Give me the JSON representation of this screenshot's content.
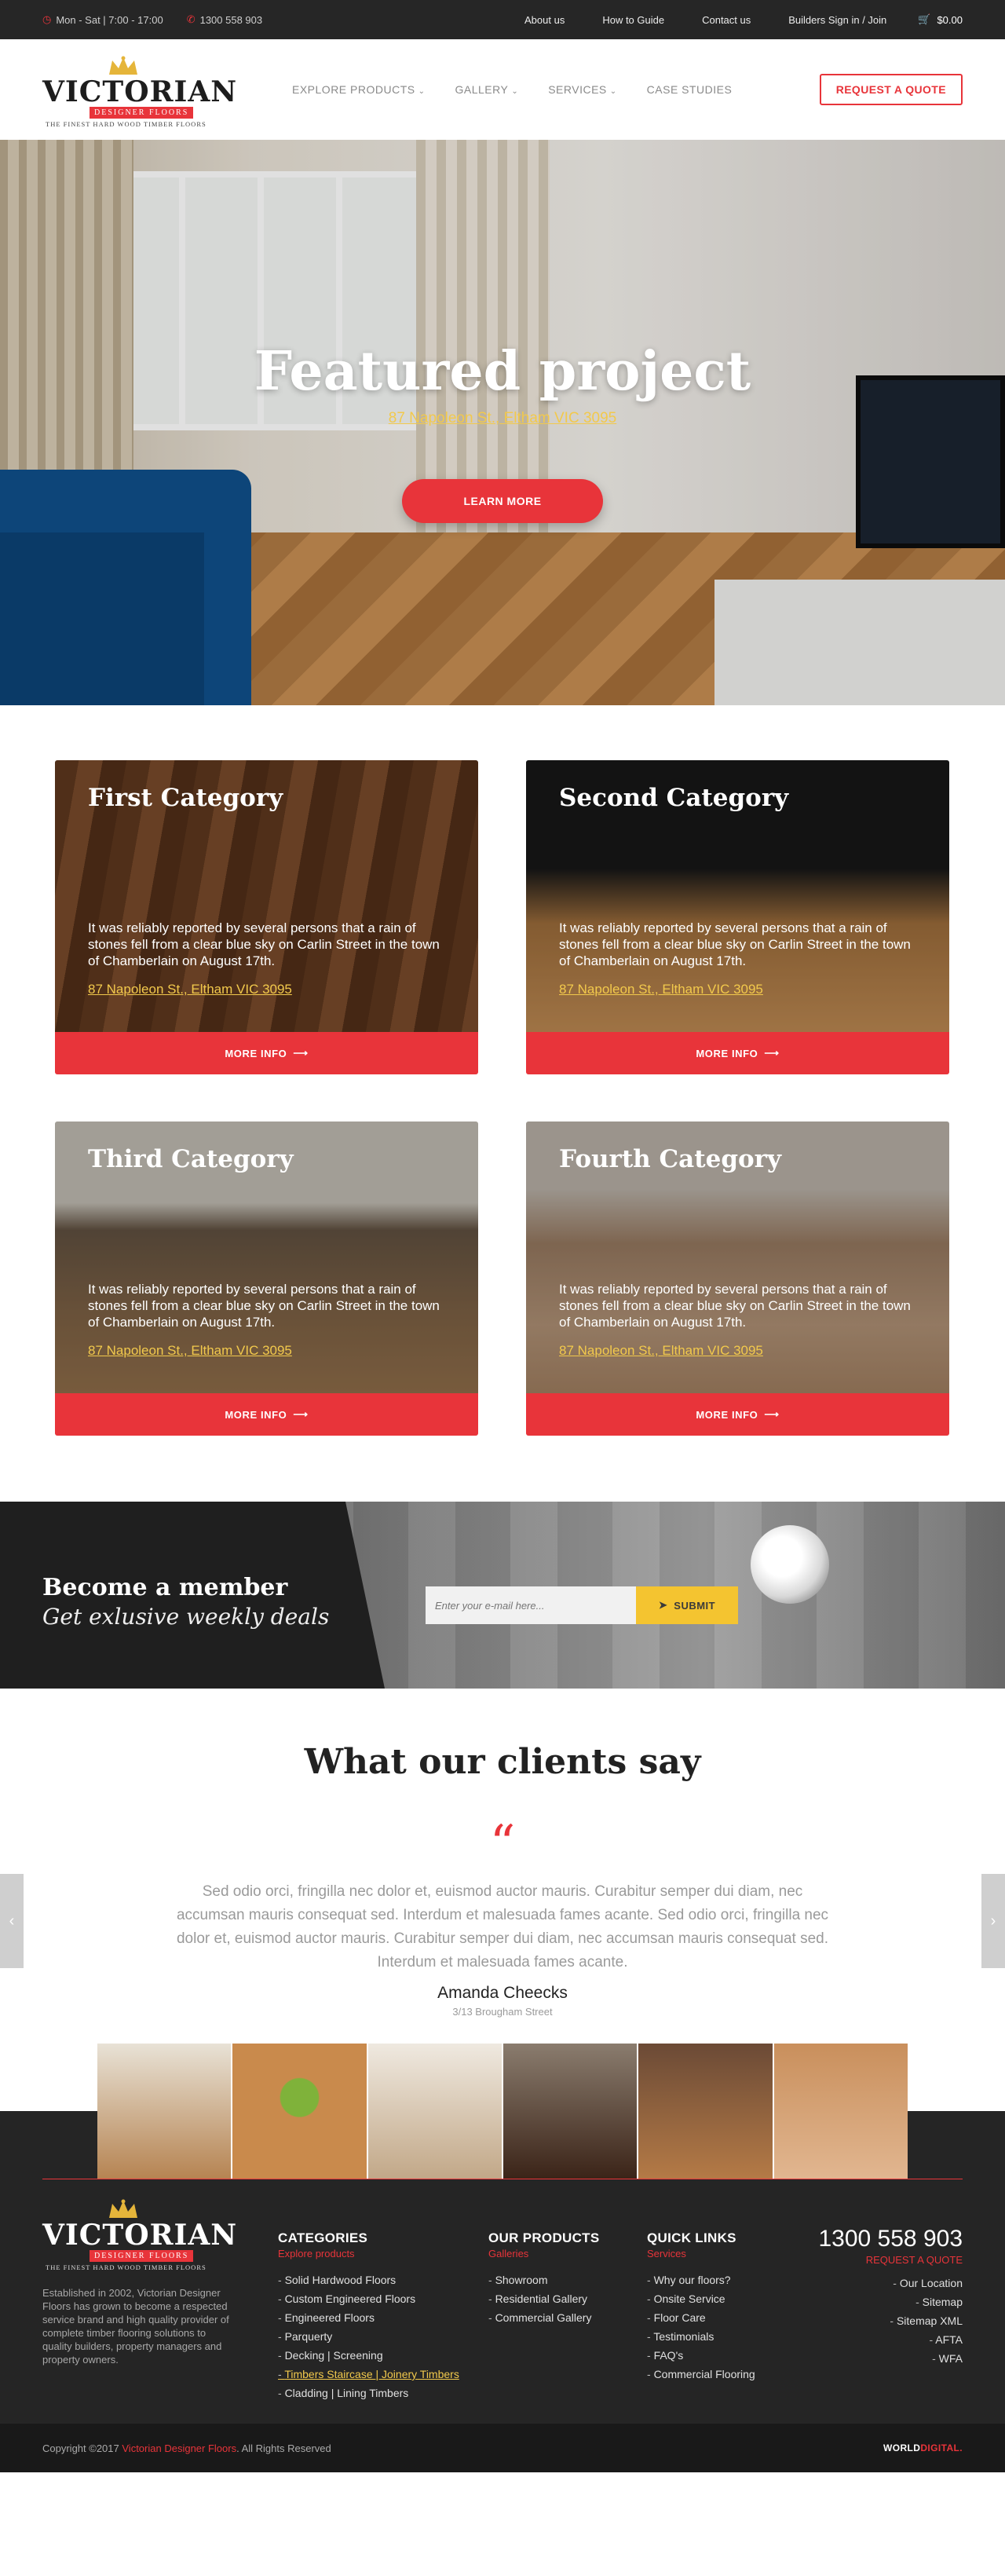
{
  "topbar": {
    "hours": "Mon - Sat | 7:00 - 17:00",
    "phone": "1300 558 903",
    "links": [
      "About us",
      "How to Guide",
      "Contact us",
      "Builders Sign in / Join"
    ],
    "cart": "$0.00"
  },
  "brand": {
    "name": "VICTORIAN",
    "sub": "DESIGNER FLOORS",
    "tagline": "THE FINEST HARD WOOD TIMBER FLOORS"
  },
  "nav": {
    "items": [
      "EXPLORE PRODUCTS",
      "GALLERY",
      "SERVICES",
      "CASE STUDIES"
    ],
    "cta": "REQUEST A QUOTE"
  },
  "hero": {
    "title": "Featured project",
    "address": "87 Napoleon St., Eltham VIC 3095",
    "button": "LEARN MORE"
  },
  "categories": [
    {
      "title": "First Category",
      "text": "It was reliably reported by several persons that a rain of stones fell from a clear blue sky on Carlin Street in the town of Chamberlain on August 17th.",
      "address": "87 Napoleon St., Eltham VIC 3095",
      "button": "MORE INFO"
    },
    {
      "title": "Second Category",
      "text": "It was reliably reported by several persons that a rain of stones fell from a clear blue sky on Carlin Street in the town of Chamberlain on August 17th.",
      "address": "87 Napoleon St., Eltham VIC 3095",
      "button": "MORE INFO"
    },
    {
      "title": "Third Category",
      "text": "It was reliably reported by several persons that a rain of stones fell from a clear blue sky on Carlin Street in the town of Chamberlain on August 17th.",
      "address": "87 Napoleon St., Eltham VIC 3095",
      "button": "MORE INFO"
    },
    {
      "title": "Fourth Category",
      "text": "It was reliably reported by several persons that a rain of stones fell from a clear blue sky on Carlin Street in the town of Chamberlain on August 17th.",
      "address": "87 Napoleon St., Eltham VIC 3095",
      "button": "MORE INFO"
    }
  ],
  "member": {
    "title": "Become a member",
    "subtitle": "Get exlusive weekly deals",
    "placeholder": "Enter your e-mail here...",
    "submit": "SUBMIT"
  },
  "testimonials": {
    "heading": "What our clients say",
    "quote_mark": "“",
    "text": "Sed odio orci, fringilla nec dolor et, euismod auctor mauris. Curabitur semper dui diam, nec accumsan mauris consequat sed. Interdum et malesuada fames acante. Sed odio orci, fringilla nec dolor et, euismod auctor mauris. Curabitur semper dui diam, nec accumsan mauris consequat sed. Interdum et malesuada fames acante.",
    "name": "Amanda Cheecks",
    "location": "3/13 Brougham Street",
    "slide_count": 5,
    "active_slide": 3
  },
  "footer": {
    "about": "Established in 2002, Victorian Designer Floors has grown to become a respected service brand and high quality provider of complete timber flooring solutions to quality builders, property managers and property owners.",
    "columns": [
      {
        "title": "CATEGORIES",
        "sub": "Explore products",
        "items": [
          "Solid Hardwood Floors",
          "Custom Engineered Floors",
          "Engineered Floors",
          "Parquerty",
          "Decking | Screening",
          "Timbers Staircase | Joinery Timbers",
          "Cladding | Lining Timbers"
        ]
      },
      {
        "title": "OUR PRODUCTS",
        "sub": "Galleries",
        "items": [
          "Showroom",
          "Residential Gallery",
          "Commercial Gallery"
        ]
      },
      {
        "title": "QUICK LINKS",
        "sub": "Services",
        "items": [
          "Why our floors?",
          "Onsite Service",
          "Floor Care",
          "Testimonials",
          "FAQ's",
          "Commercial Flooring"
        ]
      }
    ],
    "phone": "1300 558 903",
    "request": "REQUEST A QUOTE",
    "right_links": [
      "Our Location",
      "Sitemap",
      "Sitemap XML",
      "AFTA",
      "WFA"
    ],
    "copyright_prefix": "Copyright ©2017",
    "copyright_brand": "Victorian Designer Floors",
    "copyright_suffix": ". All Rights Reserved",
    "credit_a": "WORLD",
    "credit_b": "DIGITAL."
  },
  "colors": {
    "accent": "#e8343a",
    "gold": "#f2c94c",
    "dark": "#262626"
  }
}
